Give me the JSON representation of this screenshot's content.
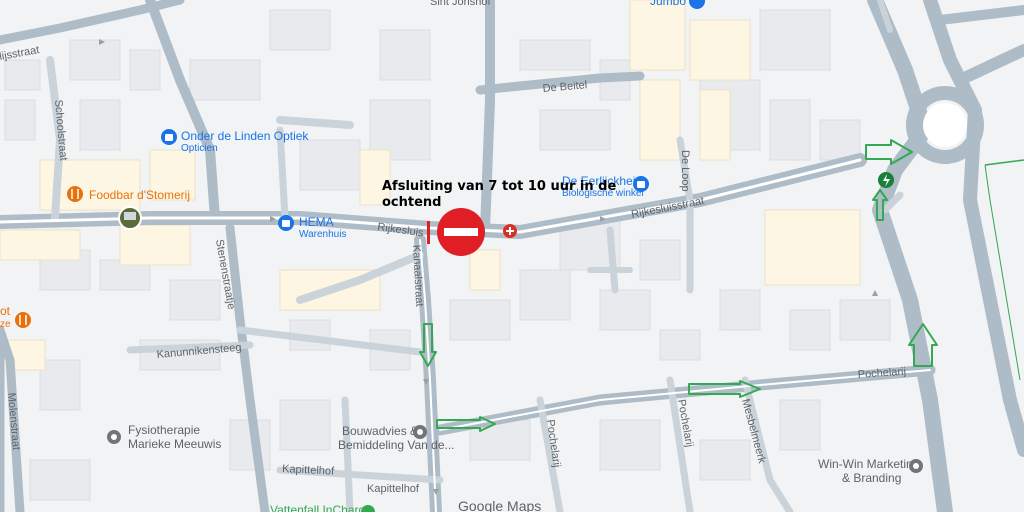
{
  "streets": {
    "rijkesluisstraat_west": "Rijkesluis",
    "rijkesluisstraat_east": "Rijkesluisstraat",
    "schoolstraat": "Schoolstraat",
    "lijsstraat": "lijsstraat",
    "sint_jorishof": "Sint Jorishof",
    "de_beitel": "De Beitel",
    "de_loop": "De Loop",
    "stenenstraatje": "Stenenstraatje",
    "kanaalstraat": "Kanaalstraat",
    "kanunnikensteeg": "Kanunnikensteeg",
    "molenstraat": "Molenstraat",
    "kapittelhof": "Kapittelhof",
    "kapittelhof_2": "Kapittelhof",
    "pochelarij": "Pochelarij",
    "pochelarij_2": "Pochelarij",
    "pochelarij_3": "Pochelarij",
    "mesbelmeen": "Mesbelmeerk"
  },
  "pois": {
    "onder_de_linden": {
      "name": "Onder de Linden Optiek",
      "category": "Opticien",
      "icon": "shopping-bag-icon",
      "color": "#1a73e8"
    },
    "foodbar": {
      "name": "Foodbar d'Stomerij",
      "icon": "fork-knife-icon",
      "color": "#e8710a"
    },
    "hema": {
      "name": "HEMA",
      "category": "Warenhuis",
      "icon": "shopping-bag-icon",
      "color": "#1a73e8"
    },
    "de_eerlijckheid": {
      "name": "De Eerlijckheid",
      "category": "Biologische winkel",
      "icon": "shopping-bag-icon",
      "color": "#1a73e8"
    },
    "jumbo": {
      "name": "Jumbo",
      "icon": "shopping-bag-icon",
      "color": "#1a73e8"
    },
    "fysiotherapie": {
      "name_line1": "Fysiotherapie",
      "name_line2": "Marieke Meeuwis",
      "icon": "poi-pin-icon",
      "color": "#70757a"
    },
    "bouwadvies": {
      "name_line1": "Bouwadvies &",
      "name_line2": "Bemiddeling Van de...",
      "icon": "poi-pin-icon",
      "color": "#70757a"
    },
    "win_win": {
      "name_line1": "Win-Win Marketing",
      "name_line2": "& Branding",
      "icon": "poi-pin-icon",
      "color": "#70757a"
    },
    "vattenfall": {
      "name": "Vattenfall InCharge",
      "icon": "ev-charger-icon"
    },
    "partial_food": {
      "name_line1": "ot",
      "name_line2": "ze",
      "icon": "fork-knife-icon",
      "color": "#e8710a"
    }
  },
  "annotation": {
    "line1": "Afsluiting van 7 tot 10 uur in de",
    "line2": "ochtend",
    "no_entry_icon": "no-entry-sign-icon",
    "no_entry_color": "#e01e26",
    "arrow_color": "#34a853"
  },
  "branding": {
    "logo": "Google Maps"
  }
}
